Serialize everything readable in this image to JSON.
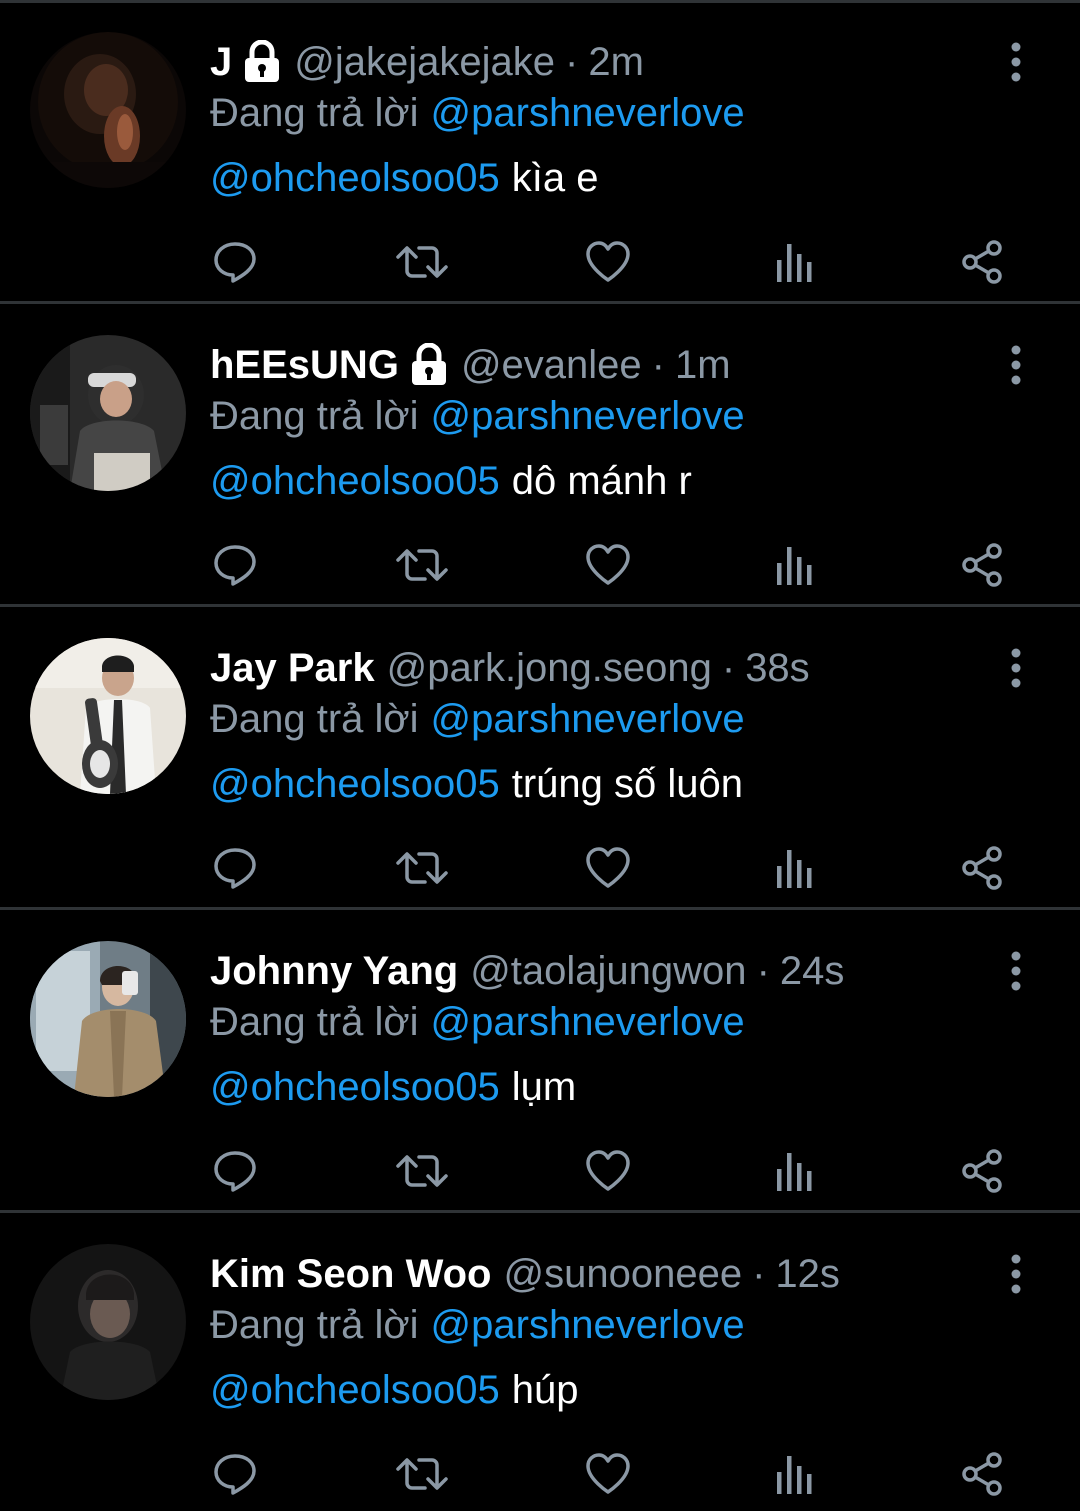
{
  "theme": {
    "background": "#000000",
    "divider": "#2f3336",
    "text_primary": "#ffffff",
    "text_secondary": "#8b98a5",
    "accent": "#1d9bf0"
  },
  "actions": [
    "reply-icon",
    "retweet-icon",
    "like-icon",
    "views-icon",
    "share-icon"
  ],
  "tweets": [
    {
      "display_name": "J",
      "locked": true,
      "handle": "@jakejakejake",
      "separator": "·",
      "time": "2m",
      "reply_prefix": "Đang trả lời",
      "reply_to": "@parshneverlove",
      "mention": "@ohcheolsoo05",
      "text": "kìa e"
    },
    {
      "display_name": "hEEsUNG",
      "locked": true,
      "handle": "@evanlee",
      "separator": "·",
      "time": "1m",
      "reply_prefix": "Đang trả lời",
      "reply_to": "@parshneverlove",
      "mention": "@ohcheolsoo05",
      "text": "dô mánh r"
    },
    {
      "display_name": "Jay Park",
      "locked": false,
      "handle": "@park.jong.seong",
      "separator": "·",
      "time": "38s",
      "reply_prefix": "Đang trả lời",
      "reply_to": "@parshneverlove",
      "mention": "@ohcheolsoo05",
      "text": "trúng số luôn"
    },
    {
      "display_name": "Johnny Yang",
      "locked": false,
      "handle": "@taolajungwon",
      "separator": "·",
      "time": "24s",
      "reply_prefix": "Đang trả lời",
      "reply_to": "@parshneverlove",
      "mention": "@ohcheolsoo05",
      "text": "lụm"
    },
    {
      "display_name": "Kim Seon Woo",
      "locked": false,
      "handle": "@sunooneee",
      "separator": "·",
      "time": "12s",
      "reply_prefix": "Đang trả lời",
      "reply_to": "@parshneverlove",
      "mention": "@ohcheolsoo05",
      "text": "húp"
    }
  ]
}
